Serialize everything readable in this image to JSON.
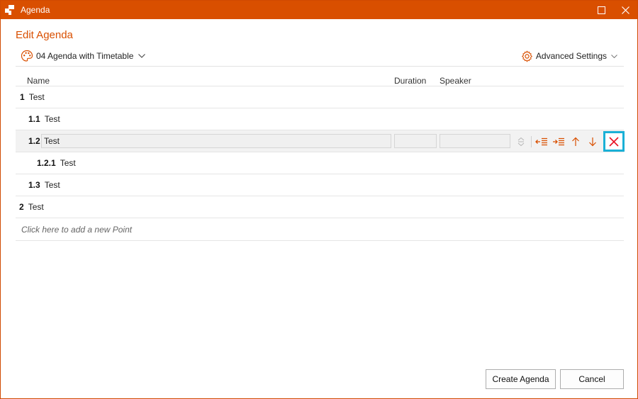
{
  "window": {
    "title": "Agenda"
  },
  "dialog": {
    "heading": "Edit Agenda",
    "template": {
      "label": "04 Agenda with Timetable",
      "icon": "palette-icon"
    },
    "advanced_settings": {
      "label": "Advanced Settings",
      "icon": "gear-icon"
    },
    "columns": {
      "name": "Name",
      "duration": "Duration",
      "speaker": "Speaker"
    },
    "rows": [
      {
        "num": "1",
        "name": "Test",
        "level": 0
      },
      {
        "num": "1.1",
        "name": "Test",
        "level": 1
      },
      {
        "num": "1.2",
        "name": "Test",
        "level": 1,
        "selected": true,
        "duration": "",
        "speaker": ""
      },
      {
        "num": "1.2.1",
        "name": "Test",
        "level": 2
      },
      {
        "num": "1.3",
        "name": "Test",
        "level": 1
      },
      {
        "num": "2",
        "name": "Test",
        "level": 0
      }
    ],
    "add_hint": "Click here to add a new Point",
    "buttons": {
      "create": "Create Agenda",
      "cancel": "Cancel"
    },
    "colors": {
      "accent": "#d94f00",
      "highlight": "#1ab0d6",
      "delete": "#e81123"
    }
  }
}
